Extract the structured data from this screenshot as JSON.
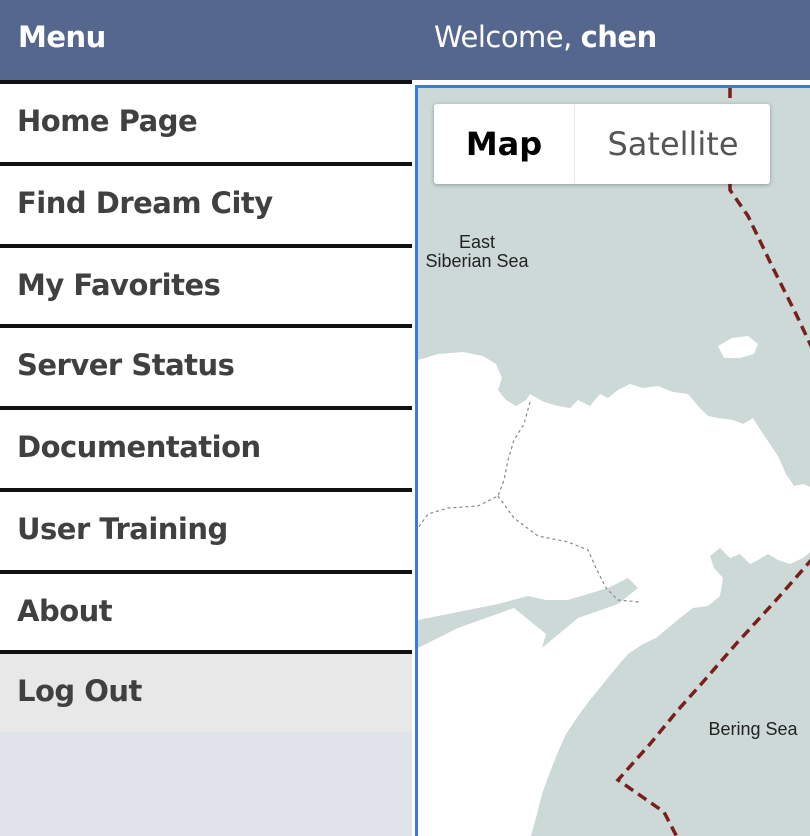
{
  "header": {
    "menu_title": "Menu",
    "welcome_prefix": "Welcome, ",
    "username": "chen"
  },
  "sidebar": {
    "items": [
      {
        "label": "Home Page"
      },
      {
        "label": "Find Dream City"
      },
      {
        "label": "My Favorites"
      },
      {
        "label": "Server Status"
      },
      {
        "label": "Documentation"
      },
      {
        "label": "User Training"
      },
      {
        "label": "About"
      },
      {
        "label": "Log Out"
      }
    ]
  },
  "map": {
    "type_control": {
      "map_label": "Map",
      "satellite_label": "Satellite",
      "selected": "Map"
    },
    "labels": {
      "sea1_line1": "East",
      "sea1_line2": "Siberian Sea",
      "sea2": "Bering Sea"
    }
  },
  "colors": {
    "header_bg": "#55668f",
    "water": "#ccd9d6",
    "land": "#ffffff",
    "boundary": "#7a1f1f",
    "map_border": "#3b78e7"
  }
}
